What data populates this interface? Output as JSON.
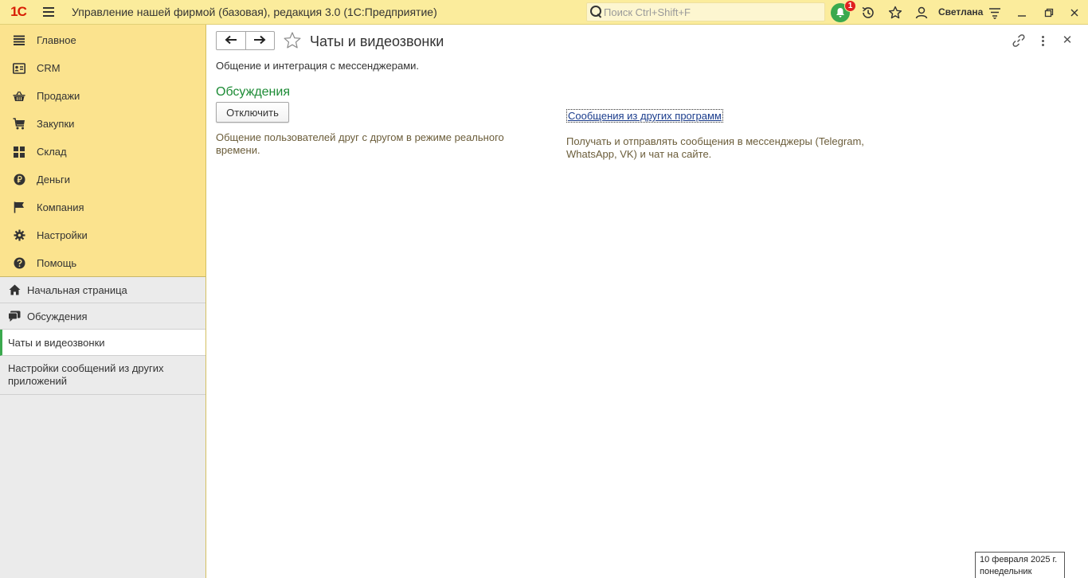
{
  "topbar": {
    "logo_text": "1С",
    "app_title": "Управление нашей фирмой (базовая), редакция 3.0  (1С:Предприятие)",
    "search_placeholder": "Поиск Ctrl+Shift+F",
    "notifications_count": "1",
    "user_name": "Светлана",
    "accent_color": "#fbec9c",
    "notification_color": "#3aa94e"
  },
  "sidebar": {
    "sections": [
      {
        "label": "Главное",
        "icon": "list-icon"
      },
      {
        "label": "CRM",
        "icon": "contact-card-icon"
      },
      {
        "label": "Продажи",
        "icon": "basket-icon"
      },
      {
        "label": "Закупки",
        "icon": "cart-icon"
      },
      {
        "label": "Склад",
        "icon": "grid-icon"
      },
      {
        "label": "Деньги",
        "icon": "ruble-icon"
      },
      {
        "label": "Компания",
        "icon": "flag-icon"
      },
      {
        "label": "Настройки",
        "icon": "gear-icon"
      },
      {
        "label": "Помощь",
        "icon": "help-icon"
      }
    ],
    "open_windows": [
      {
        "label": "Начальная страница",
        "icon": "home-icon"
      },
      {
        "label": "Обсуждения",
        "icon": "chat-icon"
      },
      {
        "label": "Чаты и видеозвонки",
        "active": true
      },
      {
        "label": "Настройки сообщений из других приложений"
      }
    ]
  },
  "main": {
    "title": "Чаты и видеозвонки",
    "subtitle": "Общение и интеграция с мессенджерами.",
    "group_title": "Обсуждения",
    "disable_button": "Отключить",
    "left_description": "Общение пользователей друг с другом в режиме реального времени.",
    "other_apps_link": "Сообщения из других программ",
    "right_description": "Получать и отправлять сообщения в мессенджеры (Telegram, WhatsApp, VK) и чат на сайте."
  },
  "datebox": {
    "date": "10 февраля 2025 г.",
    "weekday": "понедельник"
  }
}
